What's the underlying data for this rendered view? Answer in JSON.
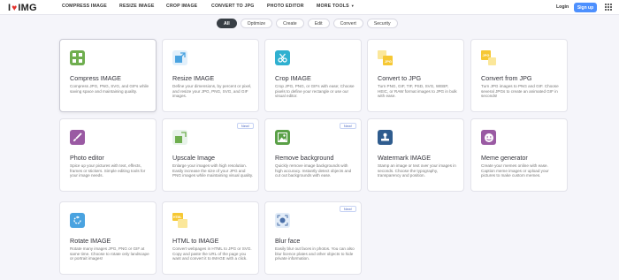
{
  "header": {
    "logo_left": "I",
    "logo_right": "IMG",
    "nav": [
      "COMPRESS IMAGE",
      "RESIZE IMAGE",
      "CROP IMAGE",
      "CONVERT TO JPG",
      "PHOTO EDITOR",
      "MORE TOOLS"
    ],
    "login": "Login",
    "signup": "Sign up"
  },
  "filters": [
    "All",
    "Optimize",
    "Create",
    "Edit",
    "Convert",
    "Security"
  ],
  "cards": [
    {
      "title": "Compress IMAGE",
      "desc": "Compress JPG, PNG, SVG, and GIFs while saving space and maintaining quality.",
      "badge": "",
      "color": "#6fae4f",
      "icon": "compress-icon"
    },
    {
      "title": "Resize IMAGE",
      "desc": "Define your dimensions, by percent or pixel, and resize your JPG, PNG, SVG, and GIF images.",
      "badge": "",
      "color": "#e2f0fb",
      "icon": "resize-icon"
    },
    {
      "title": "Crop IMAGE",
      "desc": "Crop JPG, PNG, or GIFs with ease; Choose pixels to define your rectangle or use our visual editor.",
      "badge": "",
      "color": "#2fb0d0",
      "icon": "scissors-icon"
    },
    {
      "title": "Convert to JPG",
      "desc": "Turn PNG, GIF, TIF, PSD, SVG, WEBP, HEIC, or RAW format images to JPG in bulk with ease.",
      "badge": "",
      "color": "#f6d043",
      "icon": "convert-to-jpg-icon"
    },
    {
      "title": "Convert from JPG",
      "desc": "Turn JPG images to PNG and GIF. Choose several JPGs to create an animated GIF in seconds!",
      "badge": "",
      "color": "#f6d043",
      "icon": "convert-from-jpg-icon"
    },
    {
      "title": "Photo editor",
      "desc": "Spice up your pictures with text, effects, frames or stickers. Simple editing tools for your image needs.",
      "badge": "",
      "color": "#9a5aa3",
      "icon": "brush-icon"
    },
    {
      "title": "Upscale Image",
      "desc": "Enlarge your images with high resolution. Easily increase the size of your JPG and PNG images while maintaining visual quality.",
      "badge": "New!",
      "color": "#e8f3ea",
      "icon": "upscale-icon"
    },
    {
      "title": "Remove background",
      "desc": "Quickly remove image backgrounds with high accuracy. Instantly detect objects and cut out backgrounds with ease.",
      "badge": "New!",
      "color": "#5aa047",
      "icon": "remove-background-icon"
    },
    {
      "title": "Watermark IMAGE",
      "desc": "Stamp an image or text over your images in seconds. Choose the typography, transparency and position.",
      "badge": "",
      "color": "#2f5c8e",
      "icon": "stamp-icon"
    },
    {
      "title": "Meme generator",
      "desc": "Create your memes online with ease. Caption meme images or upload your pictures to make custom memes.",
      "badge": "",
      "color": "#9a5aa3",
      "icon": "meme-icon"
    },
    {
      "title": "Rotate IMAGE",
      "desc": "Rotate many images JPG, PNG or GIF at same time. Choose to rotate only landscape or portrait images!",
      "badge": "",
      "color": "#4aa3e0",
      "icon": "rotate-icon"
    },
    {
      "title": "HTML to IMAGE",
      "desc": "Convert webpages in HTML to JPG or SVG. Copy and paste the URL of the page you want and convert it to IMAGE with a click.",
      "badge": "",
      "color": "#f6d043",
      "icon": "html-icon"
    },
    {
      "title": "Blur face",
      "desc": "Easily blur out faces in photos. You can also blur licence plates and other objects to hide private information.",
      "badge": "New!",
      "color": "#e2ecf8",
      "icon": "blur-face-icon"
    }
  ]
}
